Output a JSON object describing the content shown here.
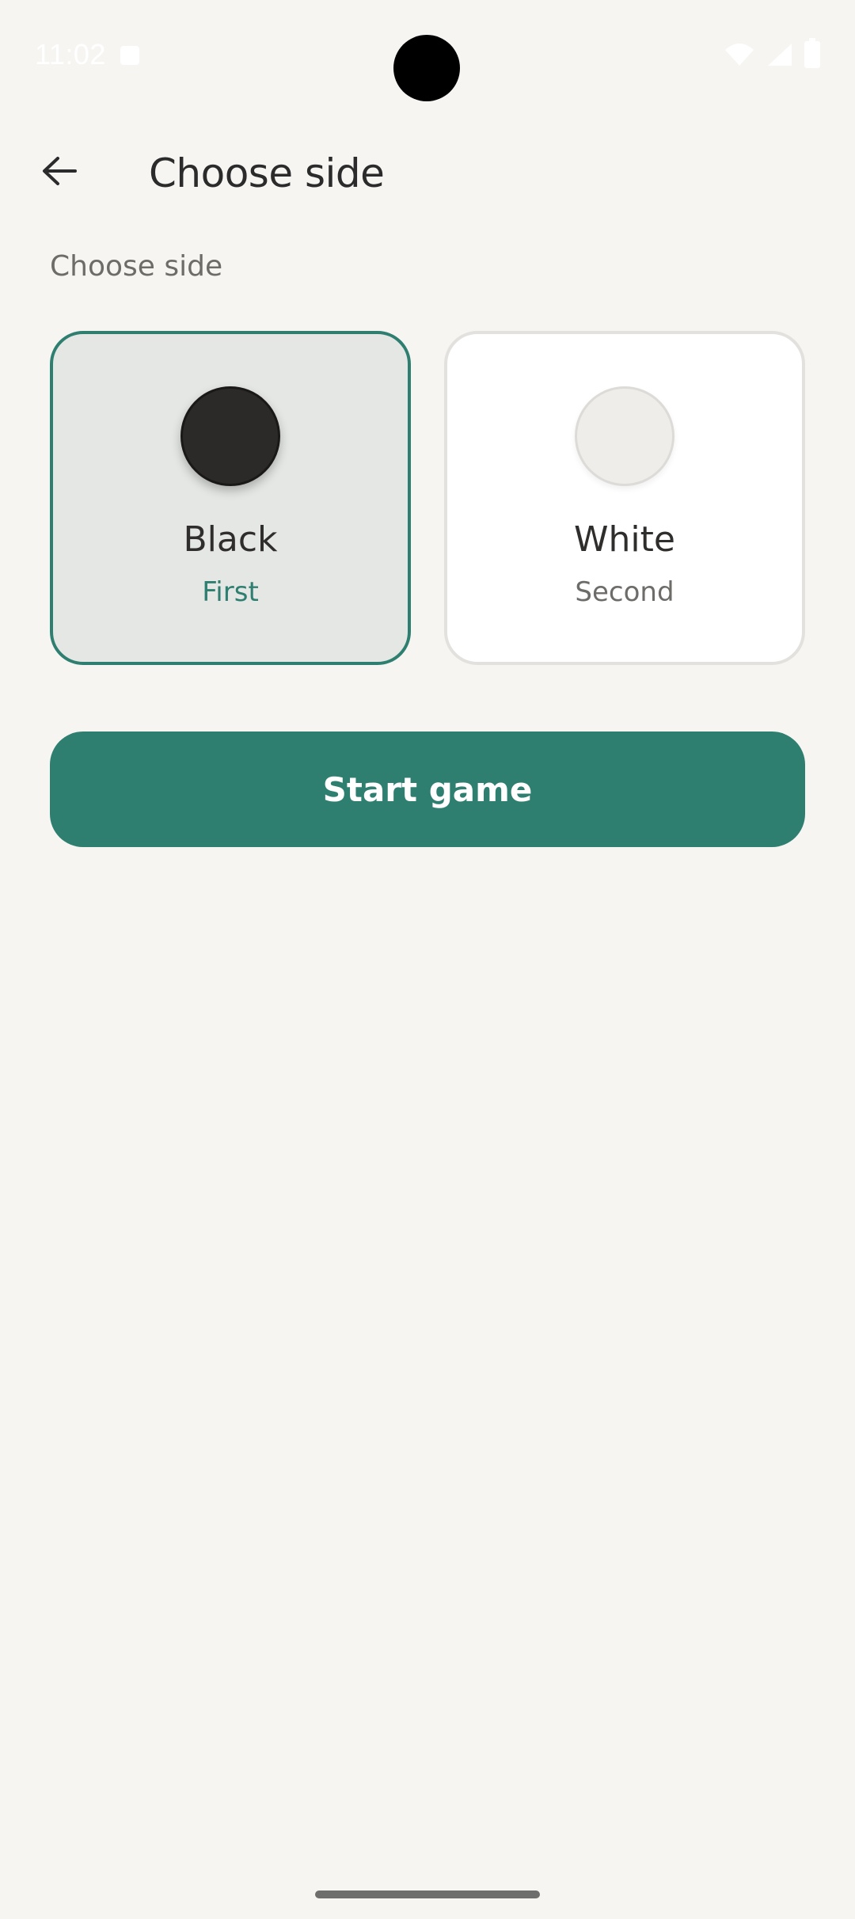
{
  "status_bar": {
    "time": "11:02"
  },
  "app_bar": {
    "title": "Choose side",
    "back_icon": "arrow-left-icon"
  },
  "section_label": "Choose side",
  "sides": [
    {
      "name": "Black",
      "order": "First",
      "selected": true,
      "stone_color": "#2c2a28"
    },
    {
      "name": "White",
      "order": "Second",
      "selected": false,
      "stone_color": "#efedea"
    }
  ],
  "start_button": {
    "label": "Start game"
  },
  "colors": {
    "accent": "#2f7f71",
    "background": "#f6f5f2",
    "selected_card": "#e4e7e4"
  }
}
